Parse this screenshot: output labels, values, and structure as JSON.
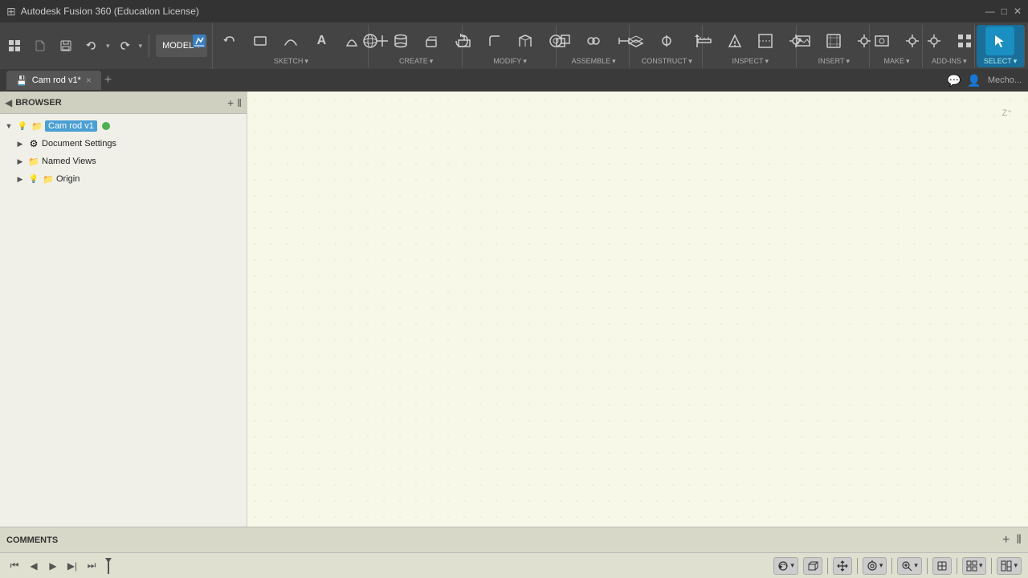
{
  "titlebar": {
    "title": "Autodesk Fusion 360 (Education License)",
    "close_label": "—"
  },
  "toolbar": {
    "model_label": "MODEL",
    "model_arrow": "▾",
    "quick_access": {
      "grid_icon": "⊞",
      "file_icon": "📄",
      "save_icon": "💾",
      "undo_icon": "↩",
      "undo_arrow": "▾",
      "redo_icon": "↪",
      "redo_arrow": "▾"
    },
    "sections": [
      {
        "id": "sketch",
        "icons": [
          "✏️",
          "↩",
          "▭",
          "⌒",
          "A",
          "⌃",
          "+"
        ],
        "label": "SKETCH",
        "has_arrow": true
      },
      {
        "id": "create",
        "icons": [
          "🌐",
          "⬡",
          "◉",
          "◱"
        ],
        "label": "CREATE",
        "has_arrow": true
      },
      {
        "id": "modify",
        "icons": [
          "⬛",
          "⊞",
          "⬡",
          "◈"
        ],
        "label": "MODIFY",
        "has_arrow": true
      },
      {
        "id": "assemble",
        "icons": [
          "⊞",
          "⊟",
          "⊞"
        ],
        "label": "ASSEMBLE",
        "has_arrow": true
      },
      {
        "id": "construct",
        "icons": [
          "◈",
          "◉",
          "✦"
        ],
        "label": "CONSTRUCT",
        "has_arrow": true
      },
      {
        "id": "inspect",
        "icons": [
          "📏",
          "🏔",
          "🖼",
          "⚙"
        ],
        "label": "INSPECT",
        "has_arrow": true
      },
      {
        "id": "insert",
        "icons": [
          "📷",
          "🖼",
          "⚙"
        ],
        "label": "INSERT",
        "has_arrow": true
      },
      {
        "id": "make",
        "icons": [
          "🖼",
          "⚙"
        ],
        "label": "MAKE",
        "has_arrow": true
      },
      {
        "id": "addins",
        "icons": [
          "⚙",
          "⊞"
        ],
        "label": "ADD-INS",
        "has_arrow": true
      },
      {
        "id": "select",
        "icons": [
          "↖"
        ],
        "label": "SELECT",
        "has_arrow": true,
        "active": true
      }
    ]
  },
  "tab": {
    "title": "Cam rod v1*",
    "icon": "💾",
    "close": "×",
    "add": "+"
  },
  "browser": {
    "title": "BROWSER",
    "collapse_icon": "◀",
    "add_icon": "+",
    "separator_icon": "‖",
    "tree": [
      {
        "id": "root",
        "expand": "▼",
        "icon": "light",
        "extra_icon": "folder",
        "label": "Cam rod v1",
        "highlighted": true,
        "has_dot": true,
        "dot_color": "green",
        "depth": 0
      },
      {
        "id": "doc-settings",
        "expand": "▶",
        "icon": "gear",
        "label": "Document Settings",
        "highlighted": false,
        "depth": 1
      },
      {
        "id": "named-views",
        "expand": "▶",
        "icon": "folder",
        "label": "Named Views",
        "highlighted": false,
        "depth": 1
      },
      {
        "id": "origin",
        "expand": "▶",
        "icon_eye": true,
        "icon": "folder",
        "label": "Origin",
        "highlighted": false,
        "depth": 1
      }
    ]
  },
  "comments": {
    "label": "COMMENTS",
    "add_icon": "+",
    "separator_icon": "‖"
  },
  "statusbar": {
    "timeline_buttons": [
      "⏮",
      "⏪",
      "▶",
      "⏩",
      "⏭"
    ],
    "viewport_buttons": [
      {
        "id": "orbit",
        "icon": "⟳",
        "has_arrow": true
      },
      {
        "id": "pan",
        "icon": "✋",
        "has_arrow": false
      },
      {
        "id": "look",
        "icon": "⊕",
        "has_arrow": true
      },
      {
        "id": "zoom",
        "icon": "🔍",
        "has_arrow": true
      }
    ],
    "view_buttons": [
      {
        "id": "view1",
        "icon": "▭",
        "has_arrow": false
      },
      {
        "id": "view2",
        "icon": "⊞",
        "has_arrow": true
      },
      {
        "id": "view3",
        "icon": "⊞",
        "has_arrow": true
      }
    ]
  },
  "canvas": {
    "z_label": "Z⁺"
  }
}
